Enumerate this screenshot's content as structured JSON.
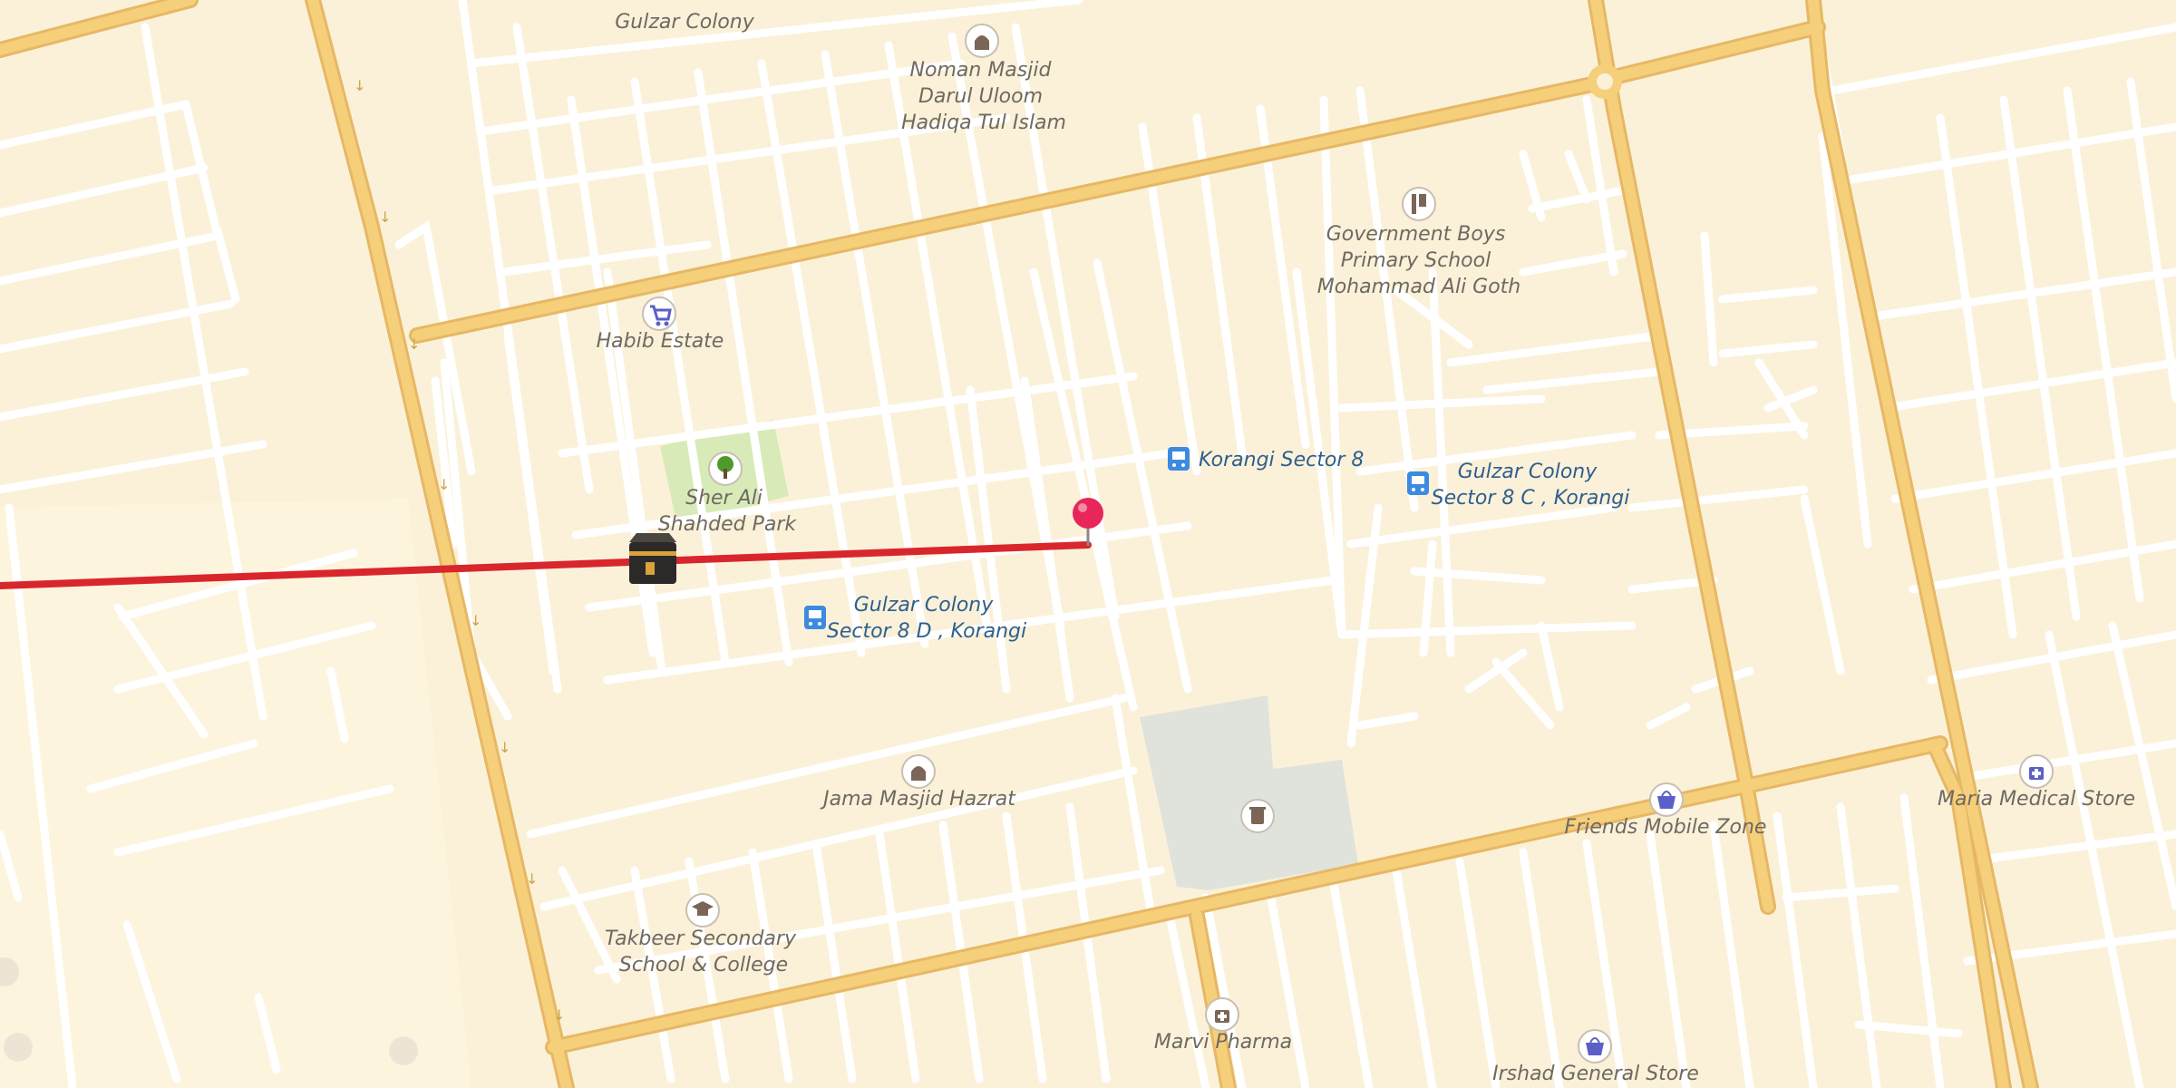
{
  "map": {
    "colors": {
      "background": "#fbf1d9",
      "minor_road": "#ffffff",
      "major_road": "#f6cf7a",
      "major_road_casing": "#e6b866",
      "park": "#d9eab9",
      "grounds": "#dfe3dc",
      "route": "#d8262c",
      "pin": "#e8265a",
      "poi_icon": "#7a6557",
      "transit_icon": "#3d8be0",
      "shop_icon": "#5b5fc7"
    },
    "labels": {
      "gulzar_colony_top": "Gulzar Colony",
      "noman_masjid": [
        "Noman Masjid",
        "Darul Uloom",
        "Hadiqa Tul Islam"
      ],
      "govt_school": [
        "Government Boys",
        "Primary School",
        "Mohammad Ali Goth"
      ],
      "habib_estate": "Habib Estate",
      "sher_ali_park": [
        "Sher Ali",
        "Shahded Park"
      ],
      "korangi_sector_8": "Korangi Sector 8",
      "gulzar_colony_8c": [
        "Gulzar Colony",
        "Sector 8 C , Korangi"
      ],
      "gulzar_colony_8d": [
        "Gulzar Colony",
        "Sector 8 D , Korangi"
      ],
      "jama_masjid": "Jama Masjid Hazrat",
      "takbeer_school": [
        "Takbeer Secondary",
        "School & College"
      ],
      "friends_mobile": "Friends Mobile Zone",
      "maria_medical": "Maria Medical Store",
      "marvi_pharma": "Marvi Pharma",
      "irshad_store": "Irshad General Store"
    },
    "icons": {
      "mosque": "mosque-icon",
      "school": "school-icon",
      "graduation": "graduation-cap-icon",
      "shopping_cart": "shopping-cart-icon",
      "tree": "tree-icon",
      "bus": "bus-stop-icon",
      "shopping_bag": "shopping-bag-icon",
      "pharmacy": "pharmacy-icon",
      "cemetery": "cemetery-icon",
      "kaaba": "kaaba-icon",
      "pin": "location-pin-icon"
    }
  }
}
